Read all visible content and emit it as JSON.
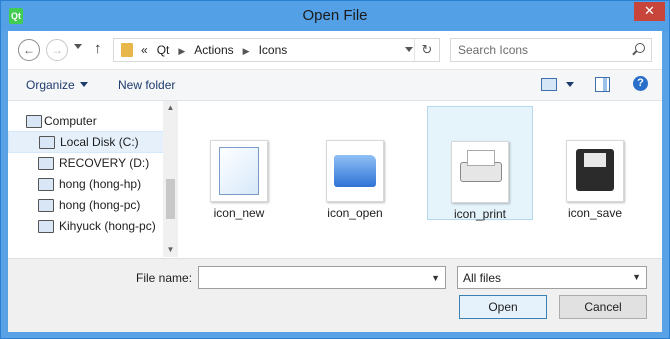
{
  "window": {
    "title": "Open File",
    "app_icon_text": "Qt",
    "close_label": "✕"
  },
  "nav": {
    "back_glyph": "←",
    "forward_glyph": "→",
    "up_glyph": "↑",
    "refresh_glyph": "↻",
    "breadcrumb": [
      "«",
      "Qt",
      "Actions",
      "Icons"
    ],
    "search_placeholder": "Search Icons"
  },
  "toolbar": {
    "organize_label": "Organize",
    "new_folder_label": "New folder",
    "help_glyph": "?"
  },
  "sidebar": {
    "items": [
      {
        "label": "Computer",
        "icon": "computer-icon"
      },
      {
        "label": "Local Disk (C:)",
        "icon": "drive-icon",
        "selected": true
      },
      {
        "label": "RECOVERY (D:)",
        "icon": "drive-icon"
      },
      {
        "label": "hong (hong-hp)",
        "icon": "network-drive-icon"
      },
      {
        "label": "hong (hong-pc)",
        "icon": "network-drive-icon"
      },
      {
        "label": "Kihyuck (hong-pc)",
        "icon": "network-drive-icon"
      }
    ],
    "scroll_up_glyph": "▲",
    "scroll_down_glyph": "▼"
  },
  "files": [
    {
      "name": "icon_new",
      "icon": "new-file-icon"
    },
    {
      "name": "icon_open",
      "icon": "open-folder-icon"
    },
    {
      "name": "icon_print",
      "icon": "printer-icon",
      "selected": true
    },
    {
      "name": "icon_save",
      "icon": "floppy-disk-icon"
    }
  ],
  "footer": {
    "file_name_label": "File name:",
    "file_name_value": "",
    "file_type": "All files",
    "dropdown_glyph": "▼",
    "open_label": "Open",
    "cancel_label": "Cancel"
  },
  "colors": {
    "titlebar": "#54a0e6",
    "close_button": "#c7453a",
    "selection": "#e5f3fb"
  }
}
